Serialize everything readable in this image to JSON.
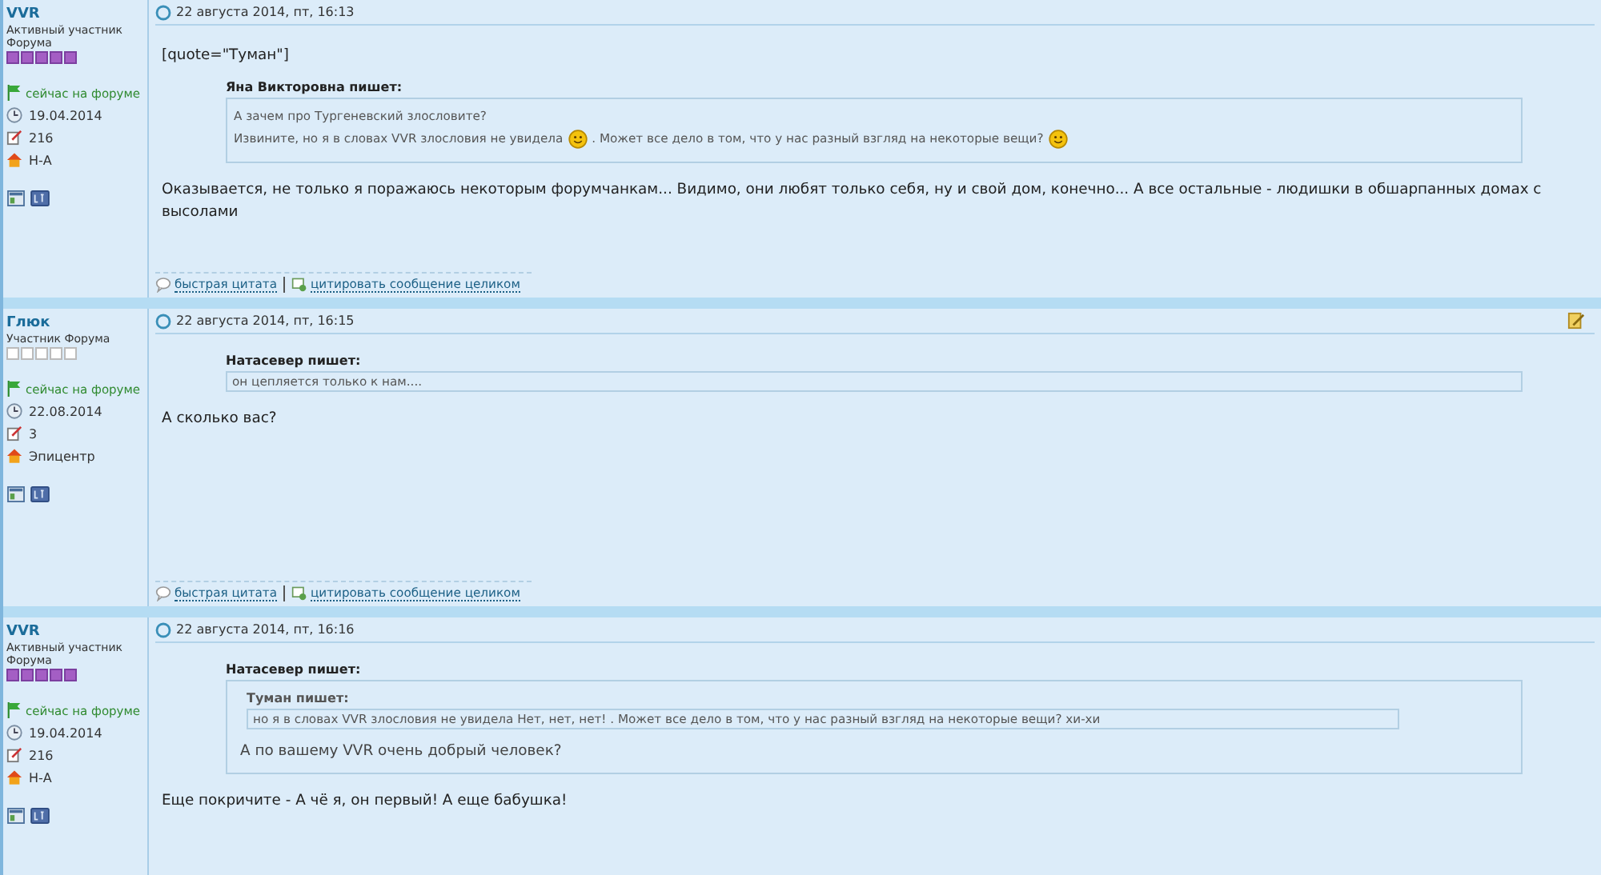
{
  "posts": [
    {
      "author": {
        "name": "VVR",
        "rank": "Активный участник Форума",
        "stars": 5,
        "online": "сейчас на форуме",
        "joined": "19.04.2014",
        "posts": "216",
        "location": "Н-А"
      },
      "date": "22 августа 2014, пт, 16:13",
      "editable": false,
      "body": [
        {
          "kind": "text",
          "text": "[quote=\"Туман\"]"
        },
        {
          "kind": "quote",
          "author": "Яна Викторовна пишет:",
          "body": [
            {
              "kind": "line",
              "parts": [
                {
                  "kind": "text",
                  "text": "А зачем про Тургеневский злословите?"
                }
              ]
            },
            {
              "kind": "line",
              "parts": [
                {
                  "kind": "text",
                  "text": "Извините, но я в словах VVR злословия не увидела"
                },
                {
                  "kind": "smiley"
                },
                {
                  "kind": "text",
                  "text": ". Может все дело в том, что у нас разный взгляд на некоторые вещи?"
                },
                {
                  "kind": "smiley"
                }
              ]
            }
          ]
        },
        {
          "kind": "text",
          "text": "Оказывается, не только я поражаюсь некоторым форумчанкам... Видимо, они любят только себя, ну и свой дом, конечно... А все остальные - людишки в обшарпанных домах с высолами"
        }
      ],
      "actions": [
        "быстрая цитата",
        "цитировать сообщение целиком"
      ]
    },
    {
      "author": {
        "name": "Глюк",
        "rank": "Участник Форума",
        "stars": 0,
        "online": "сейчас на форуме",
        "joined": "22.08.2014",
        "posts": "3",
        "location": "Эпицентр"
      },
      "date": "22 августа 2014, пт, 16:15",
      "editable": true,
      "body": [
        {
          "kind": "quote",
          "author": "Натасевер пишет:",
          "body": [
            {
              "kind": "line",
              "parts": [
                {
                  "kind": "text",
                  "text": "он цепляется только к нам...."
                }
              ]
            }
          ]
        },
        {
          "kind": "text",
          "text": "А сколько вас?"
        }
      ],
      "actions": [
        "быстрая цитата",
        "цитировать сообщение целиком"
      ]
    },
    {
      "author": {
        "name": "VVR",
        "rank": "Активный участник Форума",
        "stars": 5,
        "online": "сейчас на форуме",
        "joined": "19.04.2014",
        "posts": "216",
        "location": "Н-А"
      },
      "date": "22 августа 2014, пт, 16:16",
      "editable": false,
      "body": [
        {
          "kind": "quote",
          "author": "Натасевер пишет:",
          "body": [
            {
              "kind": "quote",
              "author": "Туман пишет:",
              "body": [
                {
                  "kind": "line",
                  "parts": [
                    {
                      "kind": "text",
                      "text": "но я в словах VVR злословия не увидела Нет, нет, нет! . Может все дело в том, что у нас разный взгляд на некоторые вещи? хи-хи"
                    }
                  ]
                }
              ]
            },
            {
              "kind": "text",
              "text": "А по вашему VVR очень добрый человек?"
            }
          ]
        },
        {
          "kind": "text",
          "text": "Еще покричите - А чё я, он первый! А еще бабушка!"
        }
      ]
    }
  ]
}
